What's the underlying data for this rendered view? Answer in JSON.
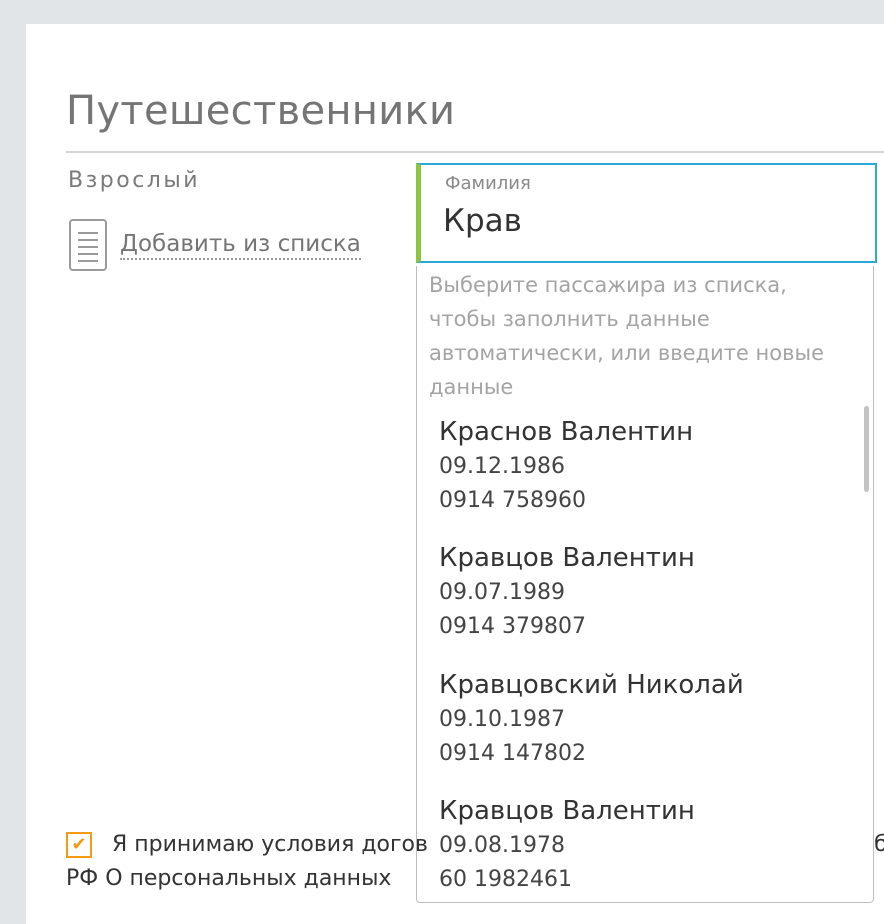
{
  "section": {
    "title": "Путешественники",
    "traveler_type": "Взрослый",
    "add_from_list": "Добавить из списка"
  },
  "surname_field": {
    "label": "Фамилия",
    "value": "Крав",
    "border_color": "#2aa8d8",
    "accent_color": "#8cc63f"
  },
  "dropdown": {
    "hint": "Выберите пассажира из списка, чтобы заполнить данные автоматически, или введите новые данные",
    "passengers": [
      {
        "name": "Краснов Валентин",
        "birth_date": "09.12.1986",
        "document": "0914 758960"
      },
      {
        "name": "Кравцов Валентин",
        "birth_date": "09.07.1989",
        "document": "0914 379807"
      },
      {
        "name": "Кравцовский Николай",
        "birth_date": "09.10.1987",
        "document": "0914 147802"
      },
      {
        "name": "Кравцов Валентин",
        "birth_date": "09.08.1978",
        "document": "60 1982461"
      }
    ]
  },
  "consent": {
    "checked": true,
    "check_glyph": "✔",
    "line1": "Я принимаю условия догов",
    "line2": "РФ О персональных данных",
    "edge_char": "б",
    "accent_color": "#f39c12"
  }
}
